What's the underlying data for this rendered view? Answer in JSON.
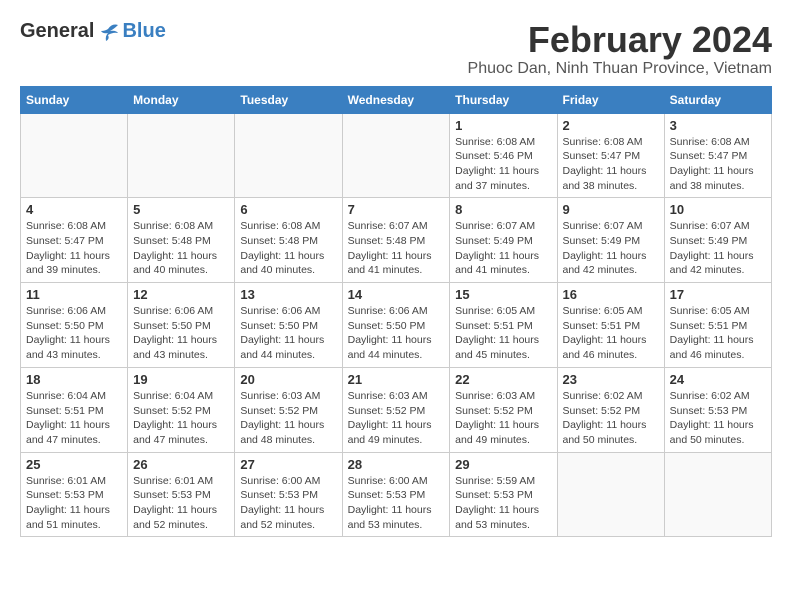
{
  "header": {
    "logo_general": "General",
    "logo_blue": "Blue",
    "title": "February 2024",
    "subtitle": "Phuoc Dan, Ninh Thuan Province, Vietnam"
  },
  "weekdays": [
    "Sunday",
    "Monday",
    "Tuesday",
    "Wednesday",
    "Thursday",
    "Friday",
    "Saturday"
  ],
  "weeks": [
    [
      {
        "day": "",
        "info": ""
      },
      {
        "day": "",
        "info": ""
      },
      {
        "day": "",
        "info": ""
      },
      {
        "day": "",
        "info": ""
      },
      {
        "day": "1",
        "info": "Sunrise: 6:08 AM\nSunset: 5:46 PM\nDaylight: 11 hours\nand 37 minutes."
      },
      {
        "day": "2",
        "info": "Sunrise: 6:08 AM\nSunset: 5:47 PM\nDaylight: 11 hours\nand 38 minutes."
      },
      {
        "day": "3",
        "info": "Sunrise: 6:08 AM\nSunset: 5:47 PM\nDaylight: 11 hours\nand 38 minutes."
      }
    ],
    [
      {
        "day": "4",
        "info": "Sunrise: 6:08 AM\nSunset: 5:47 PM\nDaylight: 11 hours\nand 39 minutes."
      },
      {
        "day": "5",
        "info": "Sunrise: 6:08 AM\nSunset: 5:48 PM\nDaylight: 11 hours\nand 40 minutes."
      },
      {
        "day": "6",
        "info": "Sunrise: 6:08 AM\nSunset: 5:48 PM\nDaylight: 11 hours\nand 40 minutes."
      },
      {
        "day": "7",
        "info": "Sunrise: 6:07 AM\nSunset: 5:48 PM\nDaylight: 11 hours\nand 41 minutes."
      },
      {
        "day": "8",
        "info": "Sunrise: 6:07 AM\nSunset: 5:49 PM\nDaylight: 11 hours\nand 41 minutes."
      },
      {
        "day": "9",
        "info": "Sunrise: 6:07 AM\nSunset: 5:49 PM\nDaylight: 11 hours\nand 42 minutes."
      },
      {
        "day": "10",
        "info": "Sunrise: 6:07 AM\nSunset: 5:49 PM\nDaylight: 11 hours\nand 42 minutes."
      }
    ],
    [
      {
        "day": "11",
        "info": "Sunrise: 6:06 AM\nSunset: 5:50 PM\nDaylight: 11 hours\nand 43 minutes."
      },
      {
        "day": "12",
        "info": "Sunrise: 6:06 AM\nSunset: 5:50 PM\nDaylight: 11 hours\nand 43 minutes."
      },
      {
        "day": "13",
        "info": "Sunrise: 6:06 AM\nSunset: 5:50 PM\nDaylight: 11 hours\nand 44 minutes."
      },
      {
        "day": "14",
        "info": "Sunrise: 6:06 AM\nSunset: 5:50 PM\nDaylight: 11 hours\nand 44 minutes."
      },
      {
        "day": "15",
        "info": "Sunrise: 6:05 AM\nSunset: 5:51 PM\nDaylight: 11 hours\nand 45 minutes."
      },
      {
        "day": "16",
        "info": "Sunrise: 6:05 AM\nSunset: 5:51 PM\nDaylight: 11 hours\nand 46 minutes."
      },
      {
        "day": "17",
        "info": "Sunrise: 6:05 AM\nSunset: 5:51 PM\nDaylight: 11 hours\nand 46 minutes."
      }
    ],
    [
      {
        "day": "18",
        "info": "Sunrise: 6:04 AM\nSunset: 5:51 PM\nDaylight: 11 hours\nand 47 minutes."
      },
      {
        "day": "19",
        "info": "Sunrise: 6:04 AM\nSunset: 5:52 PM\nDaylight: 11 hours\nand 47 minutes."
      },
      {
        "day": "20",
        "info": "Sunrise: 6:03 AM\nSunset: 5:52 PM\nDaylight: 11 hours\nand 48 minutes."
      },
      {
        "day": "21",
        "info": "Sunrise: 6:03 AM\nSunset: 5:52 PM\nDaylight: 11 hours\nand 49 minutes."
      },
      {
        "day": "22",
        "info": "Sunrise: 6:03 AM\nSunset: 5:52 PM\nDaylight: 11 hours\nand 49 minutes."
      },
      {
        "day": "23",
        "info": "Sunrise: 6:02 AM\nSunset: 5:52 PM\nDaylight: 11 hours\nand 50 minutes."
      },
      {
        "day": "24",
        "info": "Sunrise: 6:02 AM\nSunset: 5:53 PM\nDaylight: 11 hours\nand 50 minutes."
      }
    ],
    [
      {
        "day": "25",
        "info": "Sunrise: 6:01 AM\nSunset: 5:53 PM\nDaylight: 11 hours\nand 51 minutes."
      },
      {
        "day": "26",
        "info": "Sunrise: 6:01 AM\nSunset: 5:53 PM\nDaylight: 11 hours\nand 52 minutes."
      },
      {
        "day": "27",
        "info": "Sunrise: 6:00 AM\nSunset: 5:53 PM\nDaylight: 11 hours\nand 52 minutes."
      },
      {
        "day": "28",
        "info": "Sunrise: 6:00 AM\nSunset: 5:53 PM\nDaylight: 11 hours\nand 53 minutes."
      },
      {
        "day": "29",
        "info": "Sunrise: 5:59 AM\nSunset: 5:53 PM\nDaylight: 11 hours\nand 53 minutes."
      },
      {
        "day": "",
        "info": ""
      },
      {
        "day": "",
        "info": ""
      }
    ]
  ]
}
